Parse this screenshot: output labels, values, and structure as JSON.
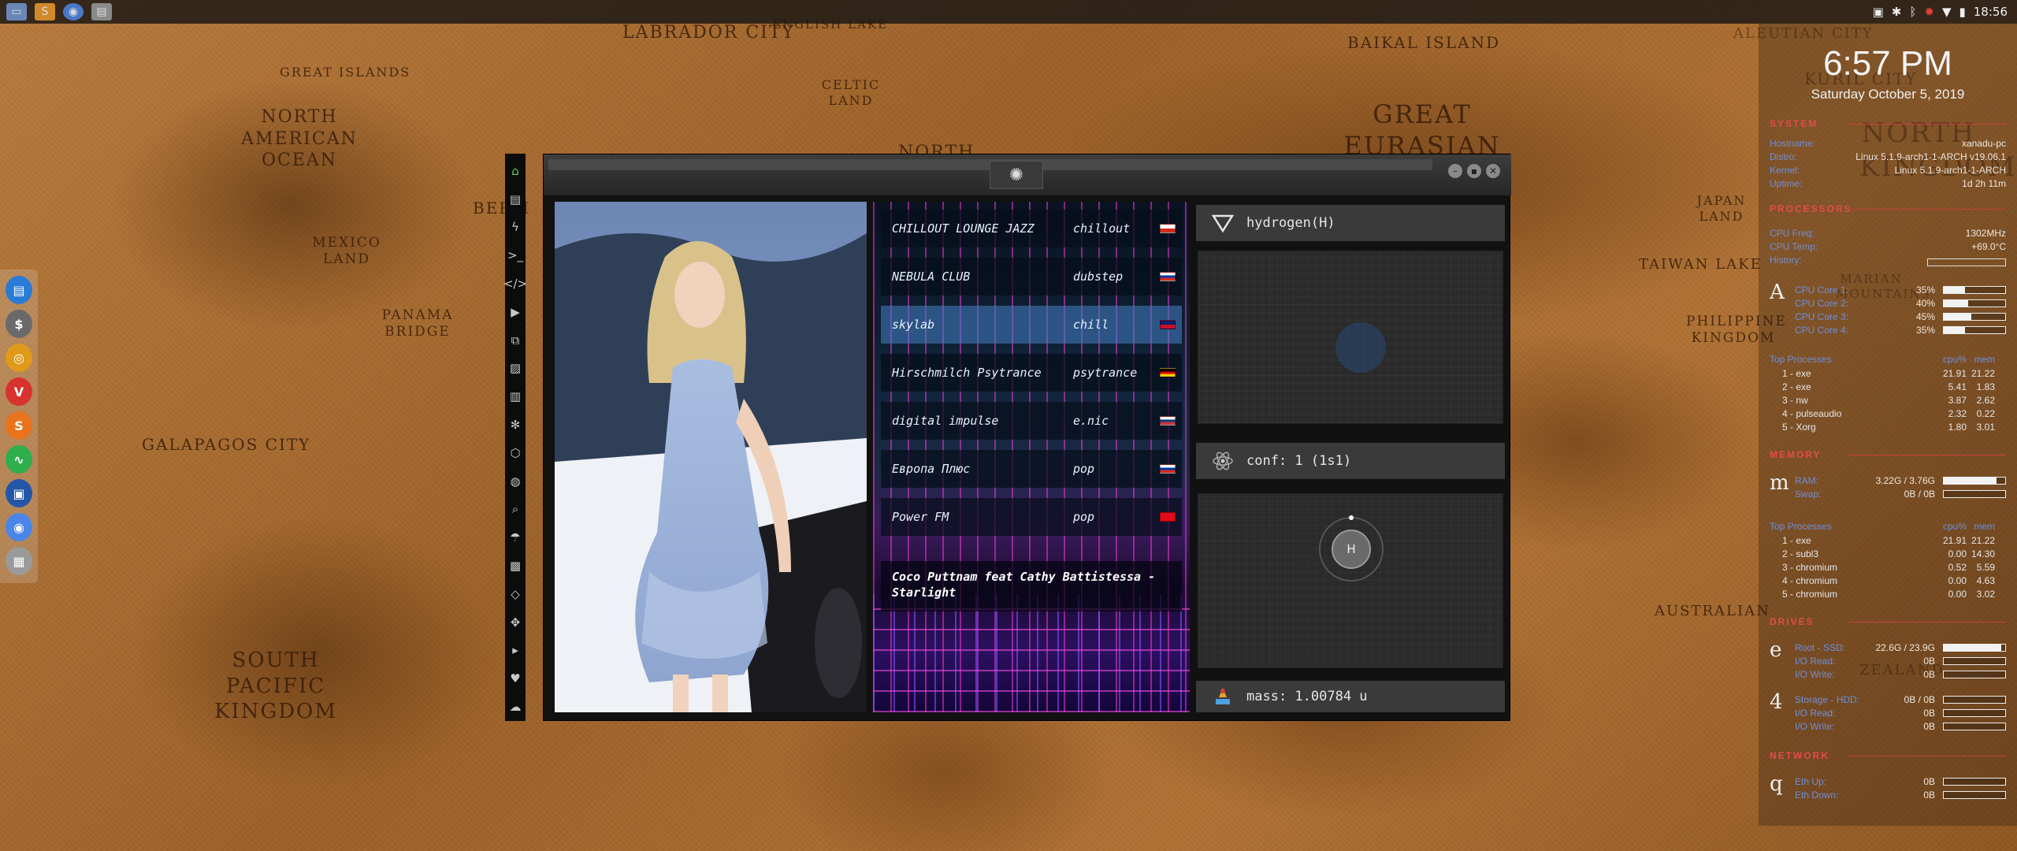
{
  "taskbar": {
    "apps": [
      {
        "name": "files",
        "icon": "folder-icon"
      },
      {
        "name": "sublime",
        "icon": "sublime-icon"
      },
      {
        "name": "chromium",
        "icon": "chromium-icon"
      },
      {
        "name": "desktop",
        "icon": "desktop-icon"
      }
    ],
    "tray": {
      "time": "18:56"
    }
  },
  "map_labels": [
    "LABRADOR CITY",
    "ENGLISH LAKE",
    "GREAT ISLANDS",
    "NORTH AMERICAN OCEAN",
    "CELTIC LAND",
    "MEXICO LAND",
    "PANAMA BRIDGE",
    "BERM",
    "GALAPAGOS CITY",
    "SOUTH PACIFIC KINGDOM",
    "BAIKAL ISLAND",
    "GREAT EURASIAN OCEAN",
    "KURIL CITY",
    "ALEUTIAN CITY",
    "NORTH KINGDOM",
    "JAPAN LAND",
    "TAIWAN LAKE",
    "PHILIPPINE KINGDOM",
    "MARIAN MOUNTAINS",
    "AUSTRALIAN",
    "ZEALAND",
    "NORTH"
  ],
  "dock": [
    {
      "icon": "files-icon",
      "color": "#2a7bd6"
    },
    {
      "icon": "money-icon",
      "color": "#6a6a6a"
    },
    {
      "icon": "ubuntu-icon",
      "color": "#e09a1a"
    },
    {
      "icon": "vivaldi-icon",
      "color": "#d8322e"
    },
    {
      "icon": "sublime-s-icon",
      "color": "#e8741e"
    },
    {
      "icon": "pulse-icon",
      "color": "#2fae4e"
    },
    {
      "icon": "screen-icon",
      "color": "#2456a8"
    },
    {
      "icon": "chrome-icon",
      "color": "#4a86e8"
    },
    {
      "icon": "grid-icon",
      "color": "#9a9a9a"
    }
  ],
  "sidebar": [
    {
      "icon": "home-icon",
      "color": "#6ad05a"
    },
    {
      "icon": "document-icon"
    },
    {
      "icon": "lightning-icon"
    },
    {
      "icon": "terminal-icon"
    },
    {
      "icon": "code-icon"
    },
    {
      "icon": "play-icon"
    },
    {
      "icon": "copy-icon"
    },
    {
      "icon": "image-icon"
    },
    {
      "icon": "newspaper-icon"
    },
    {
      "icon": "atom-icon"
    },
    {
      "icon": "hexagon-icon"
    },
    {
      "icon": "globe-icon"
    },
    {
      "icon": "search-icon"
    },
    {
      "icon": "umbrella-icon"
    },
    {
      "icon": "contact-icon"
    },
    {
      "icon": "diamond-arrows-icon"
    },
    {
      "icon": "expand-icon"
    },
    {
      "icon": "youtube-icon"
    },
    {
      "icon": "heart-icon"
    },
    {
      "icon": "cloud-icon"
    }
  ],
  "radio": {
    "stations": [
      {
        "name": "CHILLOUT LOUNGE JAZZ",
        "genre": "chillout",
        "flag": [
          "#ffffff",
          "#d52b1e"
        ],
        "active": false
      },
      {
        "name": "NEBULA CLUB",
        "genre": "dubstep",
        "flag": [
          "#ffffff",
          "#0039a6",
          "#d52b1e"
        ],
        "active": false
      },
      {
        "name": "skylab",
        "genre": "chill",
        "flag": [
          "#012169",
          "#c8102e"
        ],
        "active": true
      },
      {
        "name": "Hirschmilch Psytrance",
        "genre": "psytrance",
        "flag": [
          "#000000",
          "#dd0000",
          "#ffce00"
        ],
        "active": false
      },
      {
        "name": "digital impulse",
        "genre": "e.nic",
        "flag": [
          "#ffffff",
          "#0c4076",
          "#c6363c"
        ],
        "active": false
      },
      {
        "name": "Европа Плюс",
        "genre": "pop",
        "flag": [
          "#ffffff",
          "#0039a6",
          "#d52b1e"
        ],
        "active": false
      },
      {
        "name": "Power FM",
        "genre": "pop",
        "flag": [
          "#e30a17",
          "#e30a17"
        ],
        "active": false
      }
    ],
    "now_playing": "Coco Puttnam feat Cathy Battistessa - Starlight"
  },
  "chem": {
    "element": "hydrogen(H)",
    "conf": "conf: 1 (1s1)",
    "mass": "mass: 1.00784 u",
    "atom_symbol": "H"
  },
  "conky": {
    "time": "6:57 PM",
    "date": "Saturday October  5, 2019",
    "system": {
      "header": "SYSTEM",
      "rows": [
        {
          "k": "Hostname:",
          "v": "xanadu-pc"
        },
        {
          "k": "Distro:",
          "v": "Linux 5.1.9-arch1-1-ARCH v19.06.1"
        },
        {
          "k": "Kernel:",
          "v": "Linux 5.1.9-arch1-1-ARCH"
        },
        {
          "k": "Uptime:",
          "v": "1d 2h 11m"
        }
      ]
    },
    "processors": {
      "header": "PROCESSORS",
      "rows": [
        {
          "k": "CPU Freq:",
          "v": "1302MHz"
        },
        {
          "k": "CPU Temp:",
          "v": "+69.0°C"
        },
        {
          "k": "History:",
          "v": ""
        }
      ],
      "letter": "A",
      "cores": [
        {
          "k": "CPU Core 1:",
          "v": "35%",
          "p": 0.35
        },
        {
          "k": "CPU Core 2:",
          "v": "40%",
          "p": 0.4
        },
        {
          "k": "CPU Core 3:",
          "v": "45%",
          "p": 0.45
        },
        {
          "k": "CPU Core 4:",
          "v": "35%",
          "p": 0.35
        }
      ],
      "top": {
        "header": [
          "Top Processes",
          "cpu%",
          "mem"
        ],
        "rows": [
          [
            "1 - exe",
            "21.91",
            "21.22"
          ],
          [
            "2 - exe",
            "5.41",
            "1.83"
          ],
          [
            "3 - nw",
            "3.87",
            "2.62"
          ],
          [
            "4 - pulseaudio",
            "2.32",
            "0.22"
          ],
          [
            "5 - Xorg",
            "1.80",
            "3.01"
          ]
        ]
      }
    },
    "memory": {
      "header": "MEMORY",
      "letter": "m",
      "rows": [
        {
          "k": "RAM:",
          "v": "3.22G / 3.76G",
          "p": 0.86
        },
        {
          "k": "Swap:",
          "v": "0B / 0B",
          "p": 0
        }
      ],
      "top": {
        "header": [
          "Top Processes",
          "cpu%",
          "mem"
        ],
        "rows": [
          [
            "1 - exe",
            "21.91",
            "21.22"
          ],
          [
            "2 - subl3",
            "0.00",
            "14.30"
          ],
          [
            "3 - chromium",
            "0.52",
            "5.59"
          ],
          [
            "4 - chromium",
            "0.00",
            "4.63"
          ],
          [
            "5 - chromium",
            "0.00",
            "3.02"
          ]
        ]
      }
    },
    "drives": {
      "header": "DRIVES",
      "root": {
        "letter": "e",
        "rows": [
          {
            "k": "Root - SSD:",
            "v": "22.6G / 23.9G",
            "p": 0.94
          },
          {
            "k": "I/O Read:",
            "v": "0B",
            "p": 0
          },
          {
            "k": "I/O Write:",
            "v": "0B",
            "p": 0
          }
        ]
      },
      "storage": {
        "letter": "4",
        "rows": [
          {
            "k": "Storage - HDD:",
            "v": "0B / 0B",
            "p": 0
          },
          {
            "k": "I/O Read:",
            "v": "0B",
            "p": 0
          },
          {
            "k": "I/O Write:",
            "v": "0B",
            "p": 0
          }
        ]
      }
    },
    "network": {
      "header": "NETWORK",
      "letter": "q",
      "rows": [
        {
          "k": "Eth Up:",
          "v": "0B",
          "p": 0
        },
        {
          "k": "Eth Down:",
          "v": "0B",
          "p": 0
        }
      ]
    }
  }
}
